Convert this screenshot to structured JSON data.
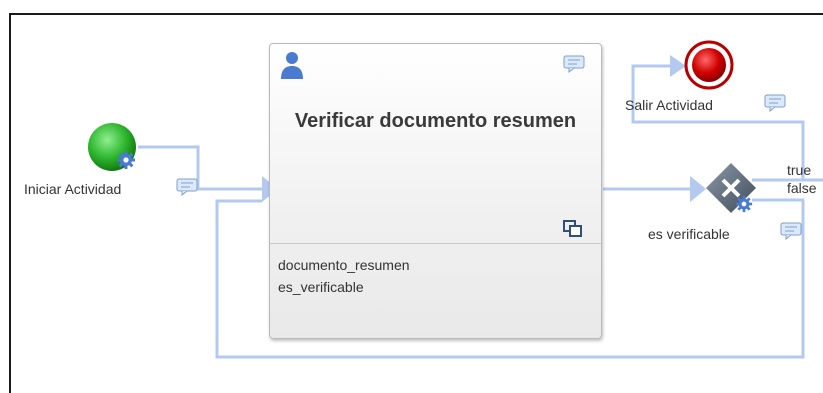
{
  "start_event": {
    "label": "Iniciar Actividad"
  },
  "task": {
    "title": "Verificar documento resumen",
    "variables": [
      "documento_resumen",
      "es_verificable"
    ]
  },
  "gateway": {
    "label": "es verificable"
  },
  "end_event": {
    "label": "Salir Actividad"
  },
  "flows": {
    "true_label": "true",
    "false_label": "false"
  },
  "icons": [
    "gear-icon",
    "comment-icon",
    "user-icon",
    "subprocess-icon",
    "exclusive-gateway-icon"
  ],
  "colors": {
    "start": "#2db52d",
    "end": "#d00000",
    "flow": "#b3c9ef",
    "gateway": "#5a6a7a",
    "accent": "#4b7bd0"
  }
}
